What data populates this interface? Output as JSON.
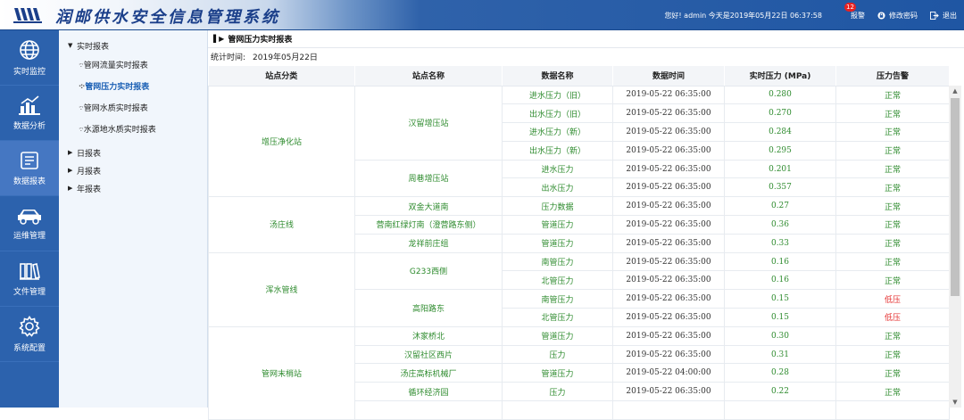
{
  "header": {
    "title": "润邮供水安全信息管理系统",
    "user_info": "您好! admin  今天是2019年05月22日 06:37:58",
    "alarm_count": "12",
    "alarm_label": "报警",
    "change_pwd_label": "修改密码",
    "logout_label": "退出"
  },
  "leftnav": [
    {
      "label": "实时监控",
      "icon": "globe-icon"
    },
    {
      "label": "数据分析",
      "icon": "bar-chart-icon"
    },
    {
      "label": "数据报表",
      "icon": "report-icon",
      "active": true
    },
    {
      "label": "运维管理",
      "icon": "car-icon"
    },
    {
      "label": "文件管理",
      "icon": "folder-icon"
    },
    {
      "label": "系统配置",
      "icon": "gear-icon"
    }
  ],
  "tree": {
    "realtime_label": "实时报表",
    "children": [
      "管网流量实时报表",
      "管网压力实时报表",
      "管网水质实时报表",
      "水源地水质实时报表"
    ],
    "daily_label": "日报表",
    "monthly_label": "月报表",
    "yearly_label": "年报表"
  },
  "main": {
    "breadcrumb": "管网压力实时报表",
    "stat_label": "统计时间:",
    "stat_value": "2019年05月22日",
    "columns": [
      "站点分类",
      "站点名称",
      "数据名称",
      "数据时间",
      "实时压力 (MPa)",
      "压力告警"
    ]
  },
  "rows": [
    {
      "category": "增压净化站",
      "cat_span": 6,
      "station": "汉留增压站",
      "st_span": 4,
      "data": "进水压力（旧）",
      "time": "2019-05-22 06:35:00",
      "pressure": "0.280",
      "alarm": "正常"
    },
    {
      "data": "出水压力（旧）",
      "time": "2019-05-22 06:35:00",
      "pressure": "0.270",
      "alarm": "正常"
    },
    {
      "data": "进水压力（新）",
      "time": "2019-05-22 06:35:00",
      "pressure": "0.284",
      "alarm": "正常"
    },
    {
      "data": "出水压力（新）",
      "time": "2019-05-22 06:35:00",
      "pressure": "0.295",
      "alarm": "正常"
    },
    {
      "station": "周巷增压站",
      "st_span": 2,
      "data": "进水压力",
      "time": "2019-05-22 06:35:00",
      "pressure": "0.201",
      "alarm": "正常"
    },
    {
      "data": "出水压力",
      "time": "2019-05-22 06:35:00",
      "pressure": "0.357",
      "alarm": "正常"
    },
    {
      "category": "汤庄线",
      "cat_span": 3,
      "station": "双金大道南",
      "st_span": 1,
      "data": "压力数据",
      "time": "2019-05-22 06:35:00",
      "pressure": "0.27",
      "alarm": "正常"
    },
    {
      "station": "营南红绿灯南（澄营路东侧）",
      "st_span": 1,
      "data": "管道压力",
      "time": "2019-05-22 06:35:00",
      "pressure": "0.36",
      "alarm": "正常"
    },
    {
      "station": "龙祥前庄组",
      "st_span": 1,
      "data": "管道压力",
      "time": "2019-05-22 06:35:00",
      "pressure": "0.33",
      "alarm": "正常"
    },
    {
      "category": "浑水管线",
      "cat_span": 4,
      "station": "G233西侧",
      "st_span": 2,
      "data": "南管压力",
      "time": "2019-05-22 06:35:00",
      "pressure": "0.16",
      "alarm": "正常"
    },
    {
      "data": "北管压力",
      "time": "2019-05-22 06:35:00",
      "pressure": "0.16",
      "alarm": "正常"
    },
    {
      "station": "高阳路东",
      "st_span": 2,
      "data": "南管压力",
      "time": "2019-05-22 06:35:00",
      "pressure": "0.15",
      "alarm": "低压",
      "low": true
    },
    {
      "data": "北管压力",
      "time": "2019-05-22 06:35:00",
      "pressure": "0.15",
      "alarm": "低压",
      "low": true
    },
    {
      "category": "管网末梢站",
      "cat_span": 5,
      "station": "沐家桥北",
      "st_span": 1,
      "data": "管道压力",
      "time": "2019-05-22 06:35:00",
      "pressure": "0.30",
      "alarm": "正常"
    },
    {
      "station": "汉留社区西片",
      "st_span": 1,
      "data": "压力",
      "time": "2019-05-22 06:35:00",
      "pressure": "0.31",
      "alarm": "正常"
    },
    {
      "station": "汤庄高标机械厂",
      "st_span": 1,
      "data": "管道压力",
      "time": "2019-05-22 04:00:00",
      "pressure": "0.28",
      "alarm": "正常"
    },
    {
      "station": "循环经济园",
      "st_span": 1,
      "data": "压力",
      "time": "2019-05-22 06:35:00",
      "pressure": "0.22",
      "alarm": "正常"
    },
    {
      "station": "",
      "st_span": 1,
      "data": "",
      "time": "",
      "pressure": "",
      "alarm": ""
    }
  ],
  "colors": {
    "header_blue": "#1f56a3",
    "nav_blue": "#2c62ad",
    "ok_green": "#2e8b2e",
    "alarm_red": "#e53030"
  }
}
